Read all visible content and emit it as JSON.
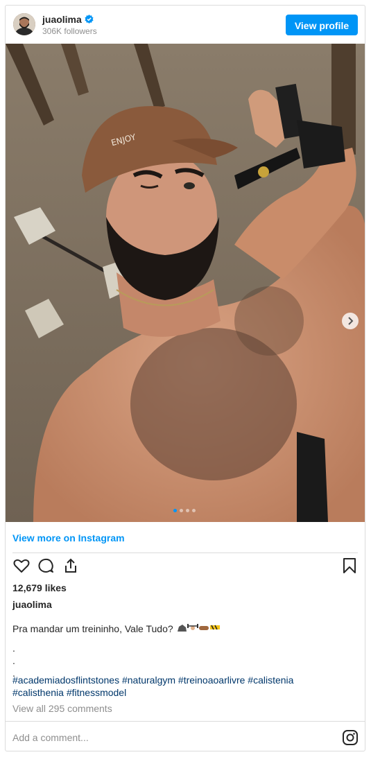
{
  "header": {
    "username": "juaolima",
    "followers": "306K followers",
    "view_profile": "View profile"
  },
  "post": {
    "view_more": "View more on Instagram",
    "likes": "12,679 likes",
    "owner": "juaolima",
    "caption_text": "Pra mandar um treininho, Vale Tudo?",
    "caption_dots": [
      ".",
      ".",
      "."
    ],
    "hashtags": "#academiadosflintstones #naturalgym #treinoaoarlivre #calistenia #calisthenia #fitnessmodel",
    "view_all_comments": "View all 295 comments",
    "add_comment_placeholder": "Add a comment...",
    "carousel": {
      "total": 4,
      "active": 0
    }
  },
  "colors": {
    "accent": "#0095f6",
    "hashtag": "#00376b",
    "muted": "#8e8e8e",
    "border": "#dbdbdb"
  }
}
